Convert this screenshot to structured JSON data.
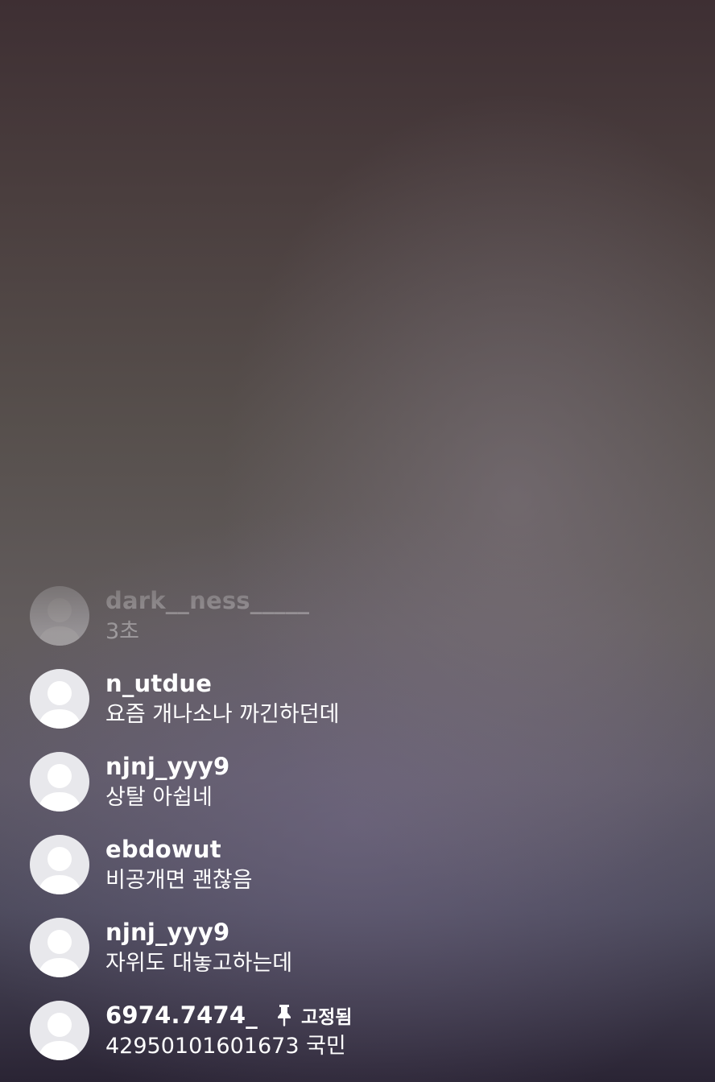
{
  "comments": [
    {
      "username": "dark__ness_____",
      "message": "3초"
    },
    {
      "username": "n_utdue",
      "message": "요즘 개나소나 까긴하던데"
    },
    {
      "username": "njnj_yyy9",
      "message": "상탈 아쉽네"
    },
    {
      "username": "ebdowut",
      "message": "비공개면 괜찮음"
    },
    {
      "username": "njnj_yyy9",
      "message": "자위도 대놓고하는데"
    },
    {
      "username": "6974.7474_",
      "message": "42950101601673 국민",
      "pinned_label": "고정됨"
    }
  ],
  "icons": {
    "avatar": "default-avatar-icon",
    "pin": "pin-icon"
  },
  "colors": {
    "text": "#ffffff",
    "avatar_bg": "#e8e8ec",
    "avatar_silhouette": "#ffffff"
  }
}
